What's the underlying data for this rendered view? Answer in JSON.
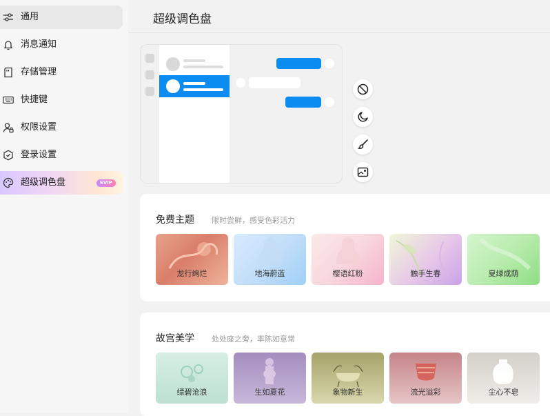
{
  "sidebar": {
    "items": [
      {
        "label": "通用",
        "icon": "sliders-icon"
      },
      {
        "label": "消息通知",
        "icon": "bell-icon"
      },
      {
        "label": "存储管理",
        "icon": "storage-card-icon"
      },
      {
        "label": "快捷键",
        "icon": "keyboard-icon"
      },
      {
        "label": "权限设置",
        "icon": "user-lock-icon"
      },
      {
        "label": "登录设置",
        "icon": "shield-icon"
      },
      {
        "label": "超级调色盘",
        "icon": "palette-icon",
        "badge": "SVIP"
      }
    ]
  },
  "header": {
    "title": "超级调色盘"
  },
  "tools": [
    "no-theme-icon",
    "moon-icon",
    "brush-icon",
    "image-icon"
  ],
  "free": {
    "title": "免费主题",
    "subtitle": "限时尝鲜，感受色彩活力",
    "themes": [
      {
        "name": "龙行绚烂"
      },
      {
        "name": "地海蔚蓝"
      },
      {
        "name": "樱语红粉"
      },
      {
        "name": "触手生春"
      },
      {
        "name": "夏绿成荫"
      }
    ]
  },
  "palace": {
    "title": "故宫美学",
    "subtitle": "处处座之旁，率陈如意常",
    "themes": [
      {
        "name": "缥碧沧浪"
      },
      {
        "name": "生如夏花"
      },
      {
        "name": "象物新生"
      },
      {
        "name": "流光溢彩"
      },
      {
        "name": "尘心不皂"
      }
    ]
  },
  "colors": {
    "accent": "#0a8cf0"
  }
}
